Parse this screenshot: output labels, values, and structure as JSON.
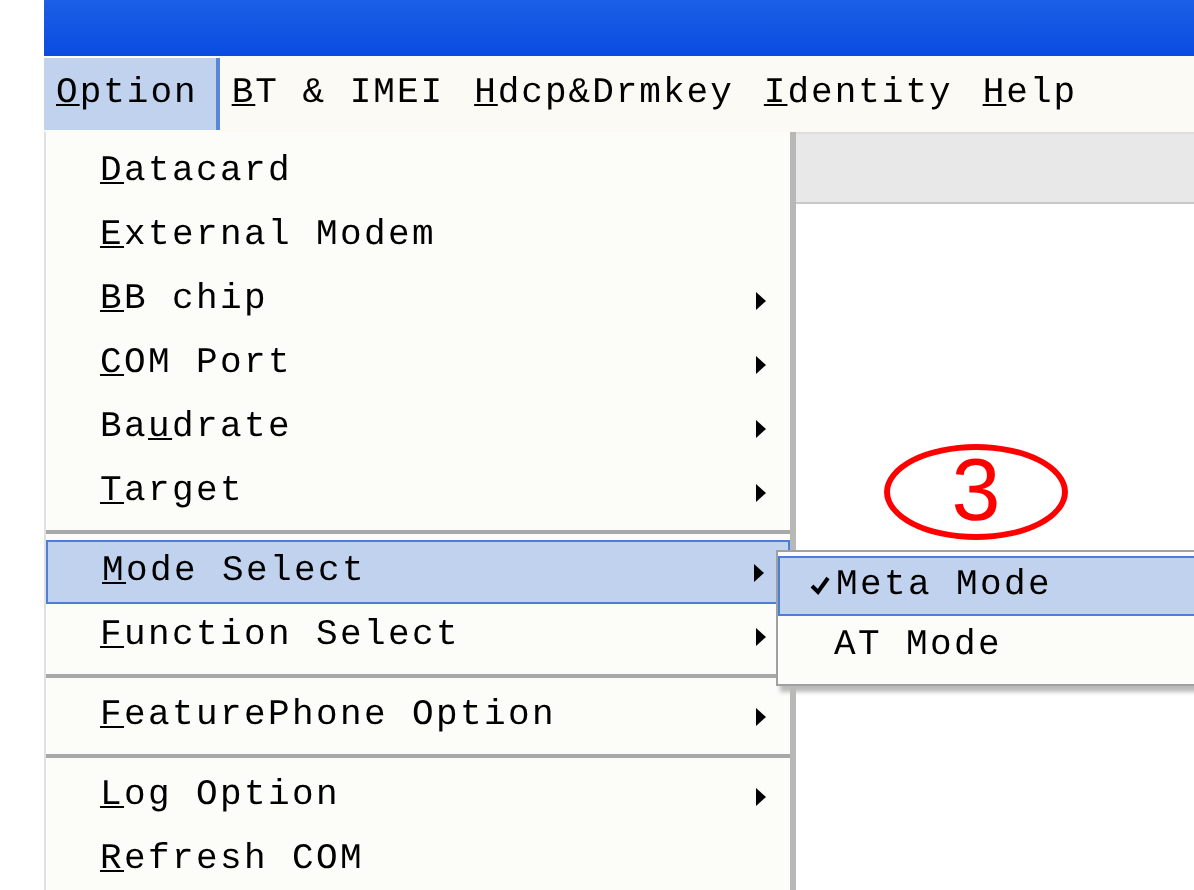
{
  "menu_bar": [
    {
      "key": "O",
      "post": "ption",
      "selected": true
    },
    {
      "key": "B",
      "post": "T & IMEI",
      "selected": false
    },
    {
      "key": "H",
      "post": "dcp&Drmkey",
      "selected": false
    },
    {
      "key": "I",
      "post": "dentity",
      "selected": false
    },
    {
      "key": "H",
      "post": "elp",
      "selected": false
    }
  ],
  "option_menu": [
    {
      "kind": "item",
      "key": "D",
      "post": "atacard",
      "submenu": false,
      "selected": false
    },
    {
      "kind": "item",
      "key": "E",
      "post": "xternal Modem",
      "submenu": false,
      "selected": false
    },
    {
      "kind": "item",
      "key": "B",
      "post": "B chip",
      "submenu": true,
      "selected": false
    },
    {
      "kind": "item",
      "key": "C",
      "post": "OM Port",
      "submenu": true,
      "selected": false
    },
    {
      "kind": "item",
      "pre": "Ba",
      "key": "u",
      "post": "drate",
      "submenu": true,
      "selected": false
    },
    {
      "kind": "item",
      "key": "T",
      "post": "arget",
      "submenu": true,
      "selected": false
    },
    {
      "kind": "separator"
    },
    {
      "kind": "item",
      "key": "M",
      "post": "ode Select",
      "submenu": true,
      "selected": true
    },
    {
      "kind": "item",
      "key": "F",
      "post": "unction Select",
      "submenu": true,
      "selected": false
    },
    {
      "kind": "separator"
    },
    {
      "kind": "item",
      "key": "F",
      "post": "eaturePhone Option",
      "submenu": true,
      "selected": false
    },
    {
      "kind": "separator"
    },
    {
      "kind": "item",
      "key": "L",
      "post": "og Option",
      "submenu": true,
      "selected": false
    },
    {
      "kind": "item",
      "key": "R",
      "post": "efresh COM",
      "submenu": false,
      "selected": false
    }
  ],
  "mode_submenu": [
    {
      "label": "Meta Mode",
      "checked": true,
      "selected": true
    },
    {
      "label": "AT Mode",
      "checked": false,
      "selected": false
    }
  ],
  "annotation": {
    "label": "3"
  }
}
